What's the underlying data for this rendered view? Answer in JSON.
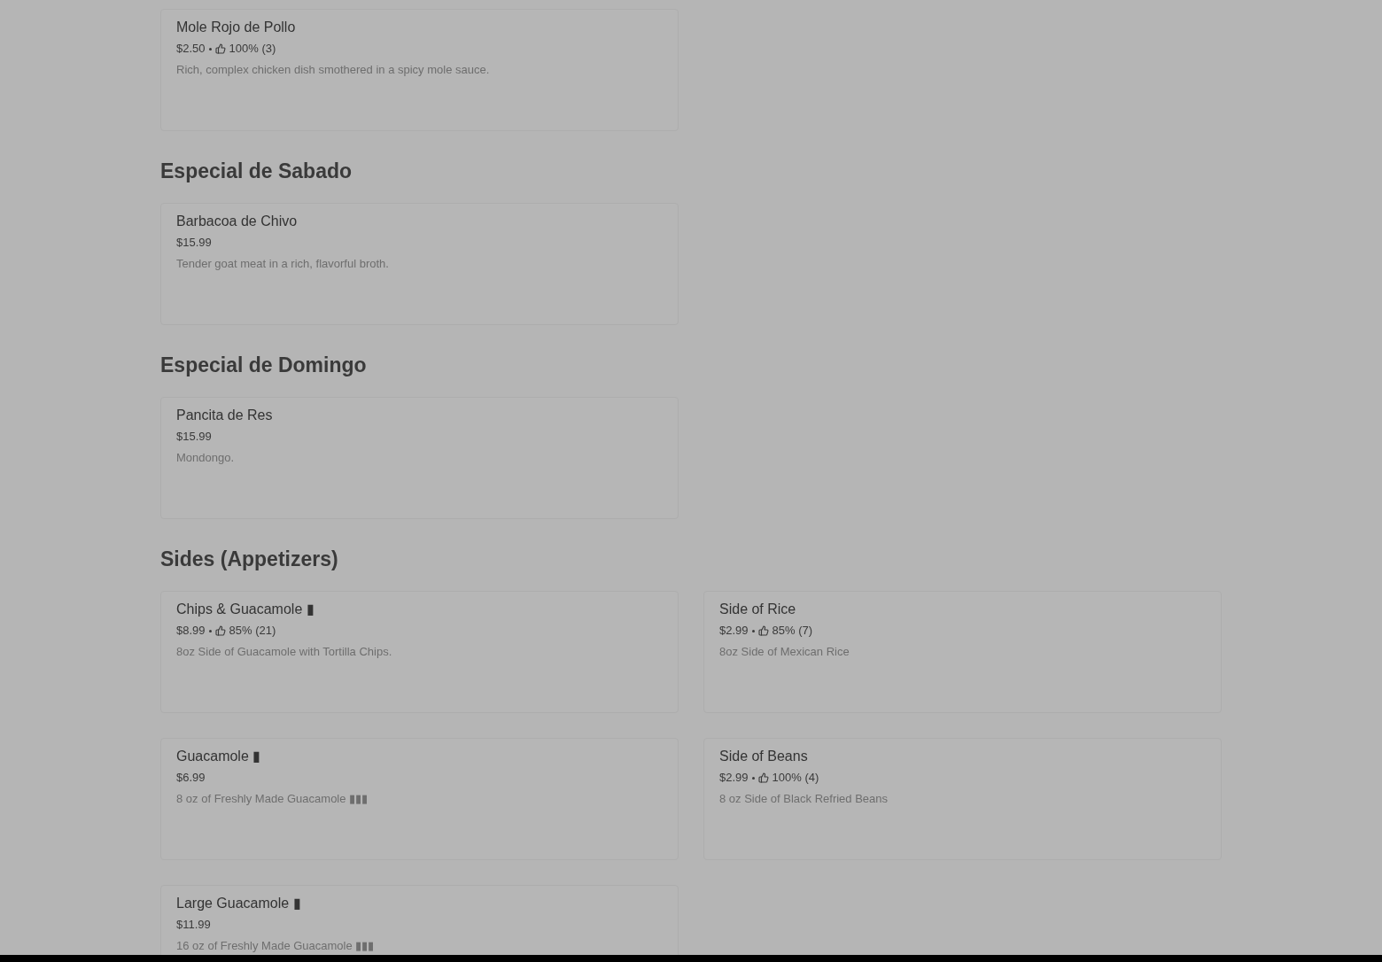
{
  "sections": [
    {
      "items": [
        {
          "name": "Mole Rojo de Pollo",
          "price": "$2.50",
          "rating": "100% (3)",
          "description": "Rich, complex chicken dish smothered in a spicy mole sauce."
        }
      ]
    },
    {
      "title": "Especial de Sabado",
      "items": [
        {
          "name": "Barbacoa de Chivo",
          "price": "$15.99",
          "description": "Tender goat meat in a rich, flavorful broth."
        }
      ]
    },
    {
      "title": "Especial de Domingo",
      "items": [
        {
          "name": "Pancita de Res",
          "price": "$15.99",
          "description": "Mondongo."
        }
      ]
    },
    {
      "title": "Sides (Appetizers)",
      "items": [
        {
          "name": "Chips & Guacamole ▮",
          "price": "$8.99",
          "rating": "85% (21)",
          "description": "8oz Side of Guacamole with Tortilla Chips."
        },
        {
          "name": "Side of Rice",
          "price": "$2.99",
          "rating": "85% (7)",
          "description": "8oz Side of Mexican Rice"
        },
        {
          "name": "Guacamole ▮",
          "price": "$6.99",
          "description": "8 oz of Freshly Made Guacamole ▮▮▮"
        },
        {
          "name": "Side of Beans",
          "price": "$2.99",
          "rating": "100% (4)",
          "description": "8 oz Side of Black Refried Beans"
        },
        {
          "name": "Large Guacamole ▮",
          "price": "$11.99",
          "description": "16 oz of Freshly Made Guacamole ▮▮▮"
        }
      ]
    }
  ]
}
